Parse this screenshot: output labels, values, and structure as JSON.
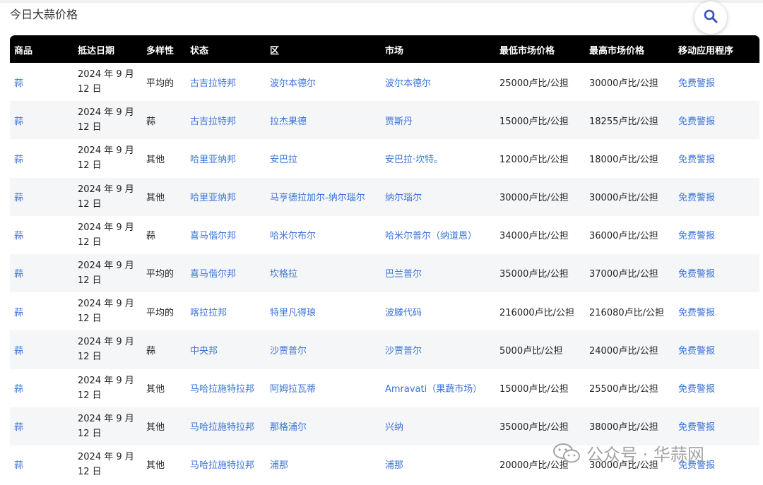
{
  "page_title": "今日大蒜价格",
  "search": {
    "icon": "search-icon"
  },
  "table": {
    "columns": [
      "商品",
      "抵达日期",
      "多样性",
      "状态",
      "区",
      "市场",
      "最低市场价格",
      "最高市场价格",
      "移动应用程序"
    ],
    "rows": [
      {
        "commodity": "蒜",
        "date": "2024 年 9 月 12 日",
        "variety": "平均的",
        "state": "古吉拉特邦",
        "district": "波尔本德尔",
        "market": "波尔本德尔",
        "min": "25000卢比/公担",
        "max": "30000卢比/公担",
        "app": "免费警报"
      },
      {
        "commodity": "蒜",
        "date": "2024 年 9 月 12 日",
        "variety": "蒜",
        "state": "古吉拉特邦",
        "district": "拉杰果德",
        "market": "贾斯丹",
        "min": "15000卢比/公担",
        "max": "18255卢比/公担",
        "app": "免费警报"
      },
      {
        "commodity": "蒜",
        "date": "2024 年 9 月 12 日",
        "variety": "其他",
        "state": "哈里亚纳邦",
        "district": "安巴拉",
        "market": "安巴拉·坎特。",
        "min": "12000卢比/公担",
        "max": "18000卢比/公担",
        "app": "免费警报"
      },
      {
        "commodity": "蒜",
        "date": "2024 年 9 月 12 日",
        "variety": "其他",
        "state": "哈里亚纳邦",
        "district": "马亨德拉加尔-纳尔瑙尔",
        "market": "纳尔瑙尔",
        "min": "30000卢比/公担",
        "max": "30000卢比/公担",
        "app": "免费警报"
      },
      {
        "commodity": "蒜",
        "date": "2024 年 9 月 12 日",
        "variety": "蒜",
        "state": "喜马偕尔邦",
        "district": "哈米尔布尔",
        "market": "哈米尔普尔（纳道恩）",
        "min": "34000卢比/公担",
        "max": "36000卢比/公担",
        "app": "免费警报"
      },
      {
        "commodity": "蒜",
        "date": "2024 年 9 月 12 日",
        "variety": "平均的",
        "state": "喜马偕尔邦",
        "district": "坎格拉",
        "market": "巴兰普尔",
        "min": "35000卢比/公担",
        "max": "37000卢比/公担",
        "app": "免费警报"
      },
      {
        "commodity": "蒜",
        "date": "2024 年 9 月 12 日",
        "variety": "平均的",
        "state": "喀拉拉邦",
        "district": "特里凡得琅",
        "market": "波滕代码",
        "min": "216000卢比/公担",
        "max": "216080卢比/公担",
        "app": "免费警报"
      },
      {
        "commodity": "蒜",
        "date": "2024 年 9 月 12 日",
        "variety": "蒜",
        "state": "中央邦",
        "district": "沙贾普尔",
        "market": "沙贾普尔",
        "min": "5000卢比/公担",
        "max": "24000卢比/公担",
        "app": "免费警报"
      },
      {
        "commodity": "蒜",
        "date": "2024 年 9 月 12 日",
        "variety": "其他",
        "state": "马哈拉施特拉邦",
        "district": "阿姆拉瓦蒂",
        "market": "Amravati（果蔬市场）",
        "min": "15000卢比/公担",
        "max": "25500卢比/公担",
        "app": "免费警报"
      },
      {
        "commodity": "蒜",
        "date": "2024 年 9 月 12 日",
        "variety": "其他",
        "state": "马哈拉施特拉邦",
        "district": "那格浦尔",
        "market": "兴纳",
        "min": "35000卢比/公担",
        "max": "38000卢比/公担",
        "app": "免费警报"
      },
      {
        "commodity": "蒜",
        "date": "2024 年 9 月 12 日",
        "variety": "其他",
        "state": "马哈拉施特拉邦",
        "district": "浦那",
        "market": "浦那",
        "min": "20000卢比/公担",
        "max": "30000卢比/公担",
        "app": "免费警报"
      }
    ]
  },
  "watermark": {
    "text": "公众号 · 华蒜网",
    "icon": "wechat-icon"
  },
  "colors": {
    "header_bg": "#000000",
    "link": "#3b73d9",
    "alt_row": "#f5f6f8"
  }
}
